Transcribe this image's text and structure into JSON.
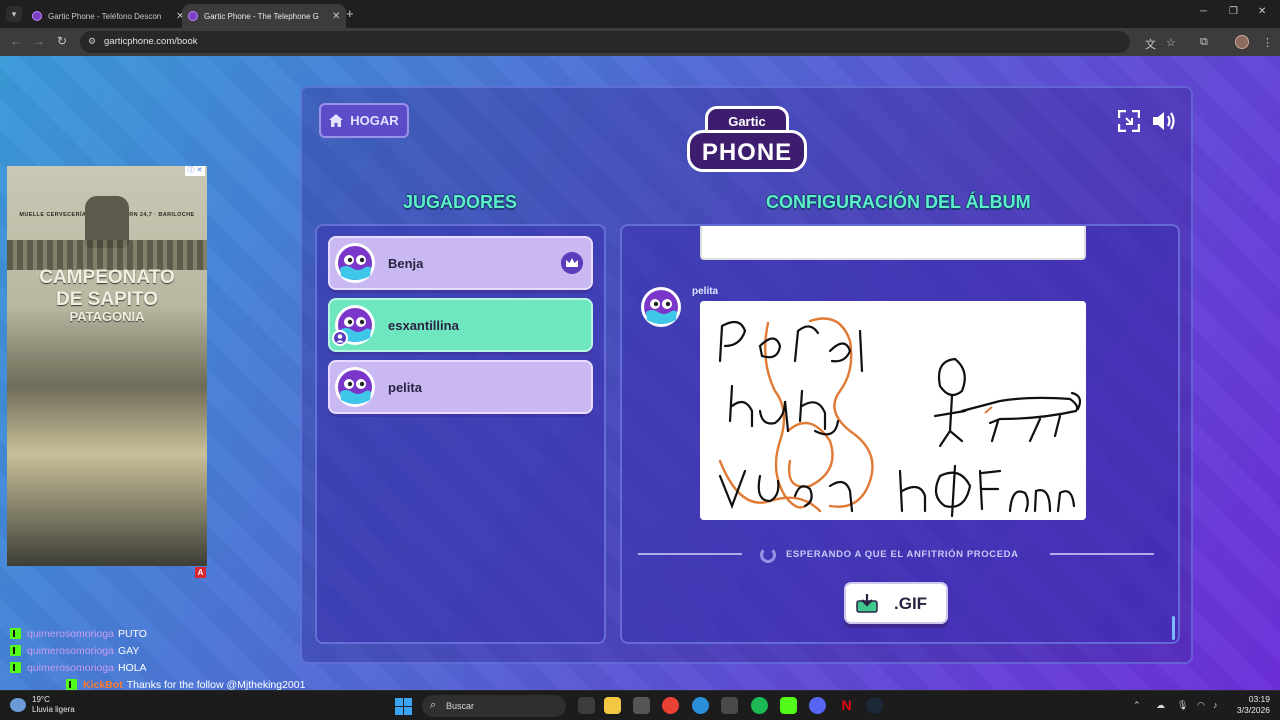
{
  "browser": {
    "tabs": [
      {
        "title": "Gartic Phone - Teléfono Descon",
        "active": false
      },
      {
        "title": "Gartic Phone - The Telephone G",
        "active": true
      }
    ],
    "url": "garticphone.com/book"
  },
  "game": {
    "home_label": "HOGAR",
    "logo_top": "Gartic",
    "logo_bottom": "PHONE",
    "players_title": "JUGADORES",
    "album_title": "CONFIGURACIÓN DEL ÁLBUM",
    "players": [
      {
        "name": "Benja",
        "host": true,
        "current": false
      },
      {
        "name": "esxantillina",
        "host": false,
        "current": true
      },
      {
        "name": "pelita",
        "host": false,
        "current": false
      }
    ],
    "album": {
      "drawer": "pelita"
    },
    "waiting_text": "ESPERANDO A QUE EL ANFITRIÓN PROCEDA",
    "gif_label": ".GIF",
    "colors": {
      "accent_green": "#5cf0c8",
      "active_player": "#6ee6c0",
      "player_card": "#c9b8f2"
    }
  },
  "ad": {
    "subtitle": "MUELLE CERVECERÍA PATAGONIA · RN 24,7 · BARILOCHE",
    "title_line1": "CAMPEONATO",
    "title_line2": "DE SAPITO",
    "title_line3": "PATAGONIA"
  },
  "chat": [
    {
      "user": "quimerosomorioga",
      "message": "PUTO",
      "bot": false
    },
    {
      "user": "quimerosomorioga",
      "message": "GAY",
      "bot": false
    },
    {
      "user": "quimerosomorioga",
      "message": "HOLA",
      "bot": false
    },
    {
      "user": "KickBot",
      "message": "Thanks for the follow @Mjtheking2001",
      "bot": true
    }
  ],
  "taskbar": {
    "temperature": "19°C",
    "weather": "Lluvia ligera",
    "search_placeholder": "Buscar",
    "time": "03:19",
    "date": "3/3/2026"
  }
}
